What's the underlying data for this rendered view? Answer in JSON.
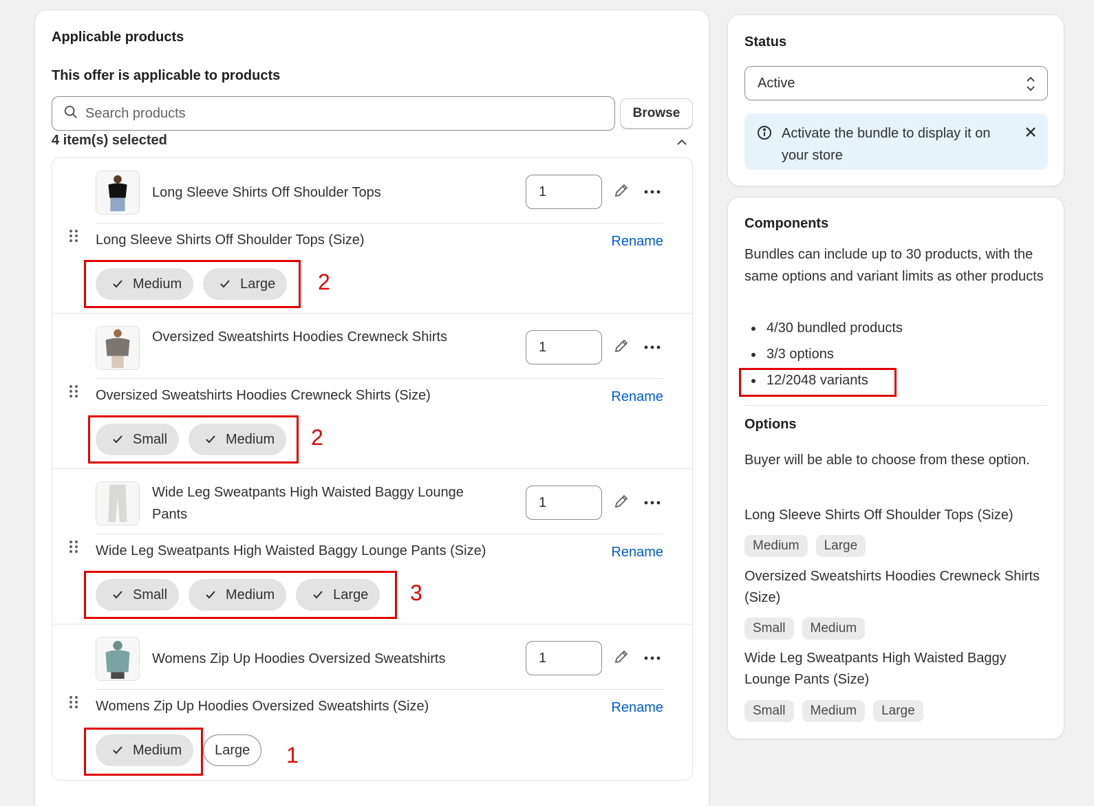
{
  "left": {
    "heading": "Applicable products",
    "subheading": "This offer is applicable to products",
    "search_placeholder": "Search products",
    "browse_label": "Browse",
    "selected_count": "4 item(s) selected",
    "rename_label": "Rename",
    "products": [
      {
        "title": "Long Sleeve Shirts Off Shoulder Tops",
        "quantity": "1",
        "option_name": "Long Sleeve Shirts Off Shoulder Tops (Size)",
        "values": [
          {
            "label": "Medium",
            "selected": true
          },
          {
            "label": "Large",
            "selected": true
          }
        ],
        "annotation": "2"
      },
      {
        "title": "Oversized Sweatshirts Hoodies Crewneck Shirts",
        "quantity": "1",
        "option_name": "Oversized Sweatshirts Hoodies Crewneck Shirts (Size)",
        "values": [
          {
            "label": "Small",
            "selected": true
          },
          {
            "label": "Medium",
            "selected": true
          }
        ],
        "annotation": "2"
      },
      {
        "title": "Wide Leg Sweatpants High Waisted Baggy Lounge Pants",
        "quantity": "1",
        "option_name": "Wide Leg Sweatpants High Waisted Baggy Lounge Pants (Size)",
        "values": [
          {
            "label": "Small",
            "selected": true
          },
          {
            "label": "Medium",
            "selected": true
          },
          {
            "label": "Large",
            "selected": true
          }
        ],
        "annotation": "3"
      },
      {
        "title": "Womens Zip Up Hoodies Oversized Sweatshirts",
        "quantity": "1",
        "option_name": "Womens Zip Up Hoodies Oversized Sweatshirts (Size)",
        "values": [
          {
            "label": "Medium",
            "selected": true
          },
          {
            "label": "Large",
            "selected": false
          }
        ],
        "annotation": "1"
      }
    ]
  },
  "status": {
    "heading": "Status",
    "selected": "Active",
    "banner_text": "Activate the bundle to display it on your store"
  },
  "components": {
    "heading": "Components",
    "description": "Bundles can include up to 30 products, with the same options and variant limits as other products",
    "stats": [
      "4/30 bundled products",
      "3/3 options",
      "12/2048 variants"
    ],
    "options_heading": "Options",
    "options_description": "Buyer will be able to choose from these option.",
    "options": [
      {
        "name": "Long Sleeve Shirts Off Shoulder Tops (Size)",
        "values": [
          "Medium",
          "Large"
        ]
      },
      {
        "name": "Oversized Sweatshirts Hoodies Crewneck Shirts (Size)",
        "values": [
          "Small",
          "Medium"
        ]
      },
      {
        "name": "Wide Leg Sweatpants High Waisted Baggy Lounge Pants (Size)",
        "values": [
          "Small",
          "Medium",
          "Large"
        ]
      }
    ]
  },
  "colors": {
    "link": "#005bd3",
    "annotation": "#e00000",
    "banner_bg": "#e6f3fb"
  }
}
